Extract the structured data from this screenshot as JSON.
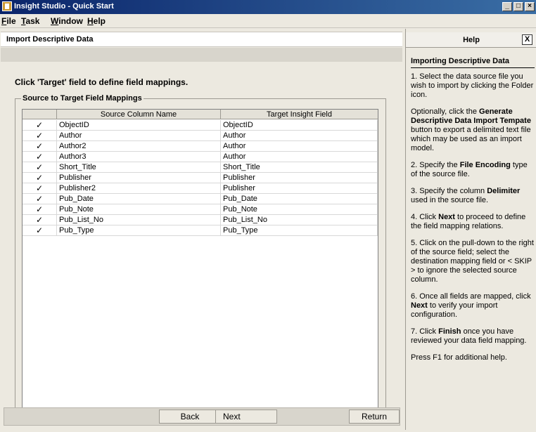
{
  "window": {
    "title": "Insight Studio - Quick Start"
  },
  "menu": [
    {
      "pre": "",
      "u": "F",
      "post": "ile"
    },
    {
      "pre": "",
      "u": "T",
      "post": "ask"
    },
    {
      "pre": "",
      "u": "W",
      "post": "indow"
    },
    {
      "pre": "",
      "u": "H",
      "post": "elp"
    }
  ],
  "panel": {
    "header": "Import Descriptive Data",
    "instruction": "Click 'Target' field to define field mappings.",
    "group_label": "Source to Target Field Mappings"
  },
  "table": {
    "columns": [
      "",
      "Source Column Name",
      "Target Insight Field"
    ],
    "rows": [
      {
        "check": "✓",
        "source": "ObjectID",
        "target": "ObjectID"
      },
      {
        "check": "✓",
        "source": "Author",
        "target": "Author"
      },
      {
        "check": "✓",
        "source": "Author2",
        "target": "Author"
      },
      {
        "check": "✓",
        "source": "Author3",
        "target": "Author"
      },
      {
        "check": "✓",
        "source": "Short_Title",
        "target": "Short_Title"
      },
      {
        "check": "✓",
        "source": "Publisher",
        "target": "Publisher"
      },
      {
        "check": "✓",
        "source": "Publisher2",
        "target": "Publisher"
      },
      {
        "check": "✓",
        "source": "Pub_Date",
        "target": "Pub_Date"
      },
      {
        "check": "✓",
        "source": "Pub_Note",
        "target": "Pub_Note"
      },
      {
        "check": "✓",
        "source": "Pub_List_No",
        "target": "Pub_List_No"
      },
      {
        "check": "✓",
        "source": "Pub_Type",
        "target": "Pub_Type"
      }
    ]
  },
  "buttons": {
    "back": "Back",
    "next": "Next",
    "return": "Return"
  },
  "help": {
    "header": "Help",
    "close": "X",
    "title": "Importing Descriptive Data",
    "paragraphs": [
      [
        {
          "t": "1. Select the data source file you wish to import by clicking the Folder icon."
        }
      ],
      [
        {
          "t": "Optionally, click the "
        },
        {
          "b": "Generate Descriptive Data Import Tempate"
        },
        {
          "t": " button to export a delimited text file which may be used as an import model."
        }
      ],
      [
        {
          "t": "2. Specify the "
        },
        {
          "b": "File Encoding"
        },
        {
          "t": " type of the source file."
        }
      ],
      [
        {
          "t": "3. Specify the column "
        },
        {
          "b": "Delimiter"
        },
        {
          "t": " used in the source file."
        }
      ],
      [
        {
          "t": "4. Click "
        },
        {
          "b": "Next"
        },
        {
          "t": " to proceed to define the field mapping relations."
        }
      ],
      [
        {
          "t": "5. Click on the pull-down to the right of the source field; select the destination mapping field or < SKIP > to ignore the selected source column."
        }
      ],
      [
        {
          "t": "6. Once all fields are mapped, click "
        },
        {
          "b": "Next"
        },
        {
          "t": " to verify your import configuration."
        }
      ],
      [
        {
          "t": "7. Click "
        },
        {
          "b": "Finish"
        },
        {
          "t": " once you have reviewed your data field mapping."
        }
      ],
      [
        {
          "t": "Press F1 for additional help."
        }
      ]
    ]
  }
}
